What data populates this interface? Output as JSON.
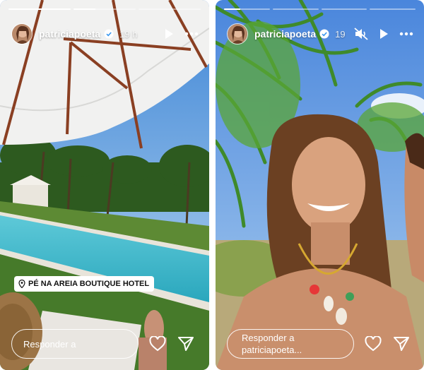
{
  "stories": [
    {
      "username": "patriciapoeta",
      "time": "19 h",
      "progress": [
        1,
        0.35,
        0
      ],
      "location": "PÉ NA AREIA BOUTIQUE HOTEL",
      "reply_placeholder": "Responder a",
      "icons": [
        "verified-badge-icon",
        "play-icon",
        "more-icon",
        "location-pin-icon",
        "heart-icon",
        "send-icon"
      ]
    },
    {
      "username": "patriciapoeta",
      "time": "19",
      "progress": [
        0.35,
        0,
        0,
        0
      ],
      "reply_placeholder_line1": "Responder a",
      "reply_placeholder_line2": "patriciapoeta...",
      "icons": [
        "verified-badge-icon",
        "muted-icon",
        "play-icon",
        "more-icon",
        "heart-icon",
        "send-icon"
      ]
    }
  ]
}
